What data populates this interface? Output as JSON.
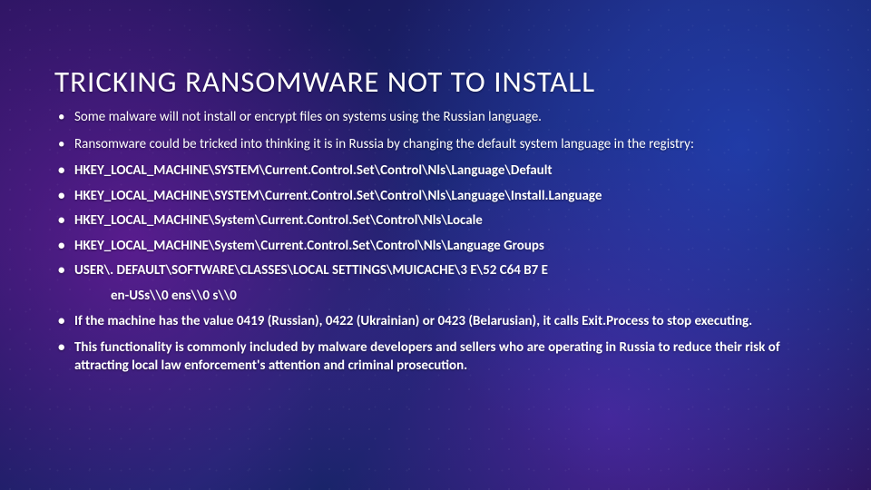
{
  "slide": {
    "title": "TRICKING RANSOMWARE NOT TO INSTALL",
    "bullets": [
      {
        "text": "Some malware will not install or encrypt files on systems using the Russian language.",
        "bold": false
      },
      {
        "text": "Ransomware could be tricked into thinking it is in Russia by changing the default system language in the registry:",
        "bold": false
      },
      {
        "text": "HKEY_LOCAL_MACHINE\\SYSTEM\\Current.Control.Set\\Control\\Nls\\Language\\Default",
        "bold": true
      },
      {
        "text": "HKEY_LOCAL_MACHINE\\SYSTEM\\Current.Control.Set\\Control\\Nls\\Language\\Install.Language",
        "bold": true
      },
      {
        "text": "HKEY_LOCAL_MACHINE\\System\\Current.Control.Set\\Control\\Nls\\Locale",
        "bold": true
      },
      {
        "text": "HKEY_LOCAL_MACHINE\\System\\Current.Control.Set\\Control\\Nls\\Language Groups",
        "bold": true
      },
      {
        "text": "USER\\. DEFAULT\\SOFTWARE\\CLASSES\\LOCAL SETTINGS\\MUICACHE\\3 E\\52 C64 B7 E",
        "bold": true
      }
    ],
    "sub_indent": "en-USs\\\\0 ens\\\\0 s\\\\0",
    "bullets_after": [
      {
        "text": "If the machine has the value 0419 (Russian), 0422 (Ukrainian) or 0423 (Belarusian), it calls Exit.Process to stop executing.",
        "bold": true
      },
      {
        "text": "This functionality is commonly included by malware developers and sellers who are operating in Russia to reduce their risk of attracting local law enforcement's attention and criminal prosecution.",
        "bold": true
      }
    ]
  }
}
